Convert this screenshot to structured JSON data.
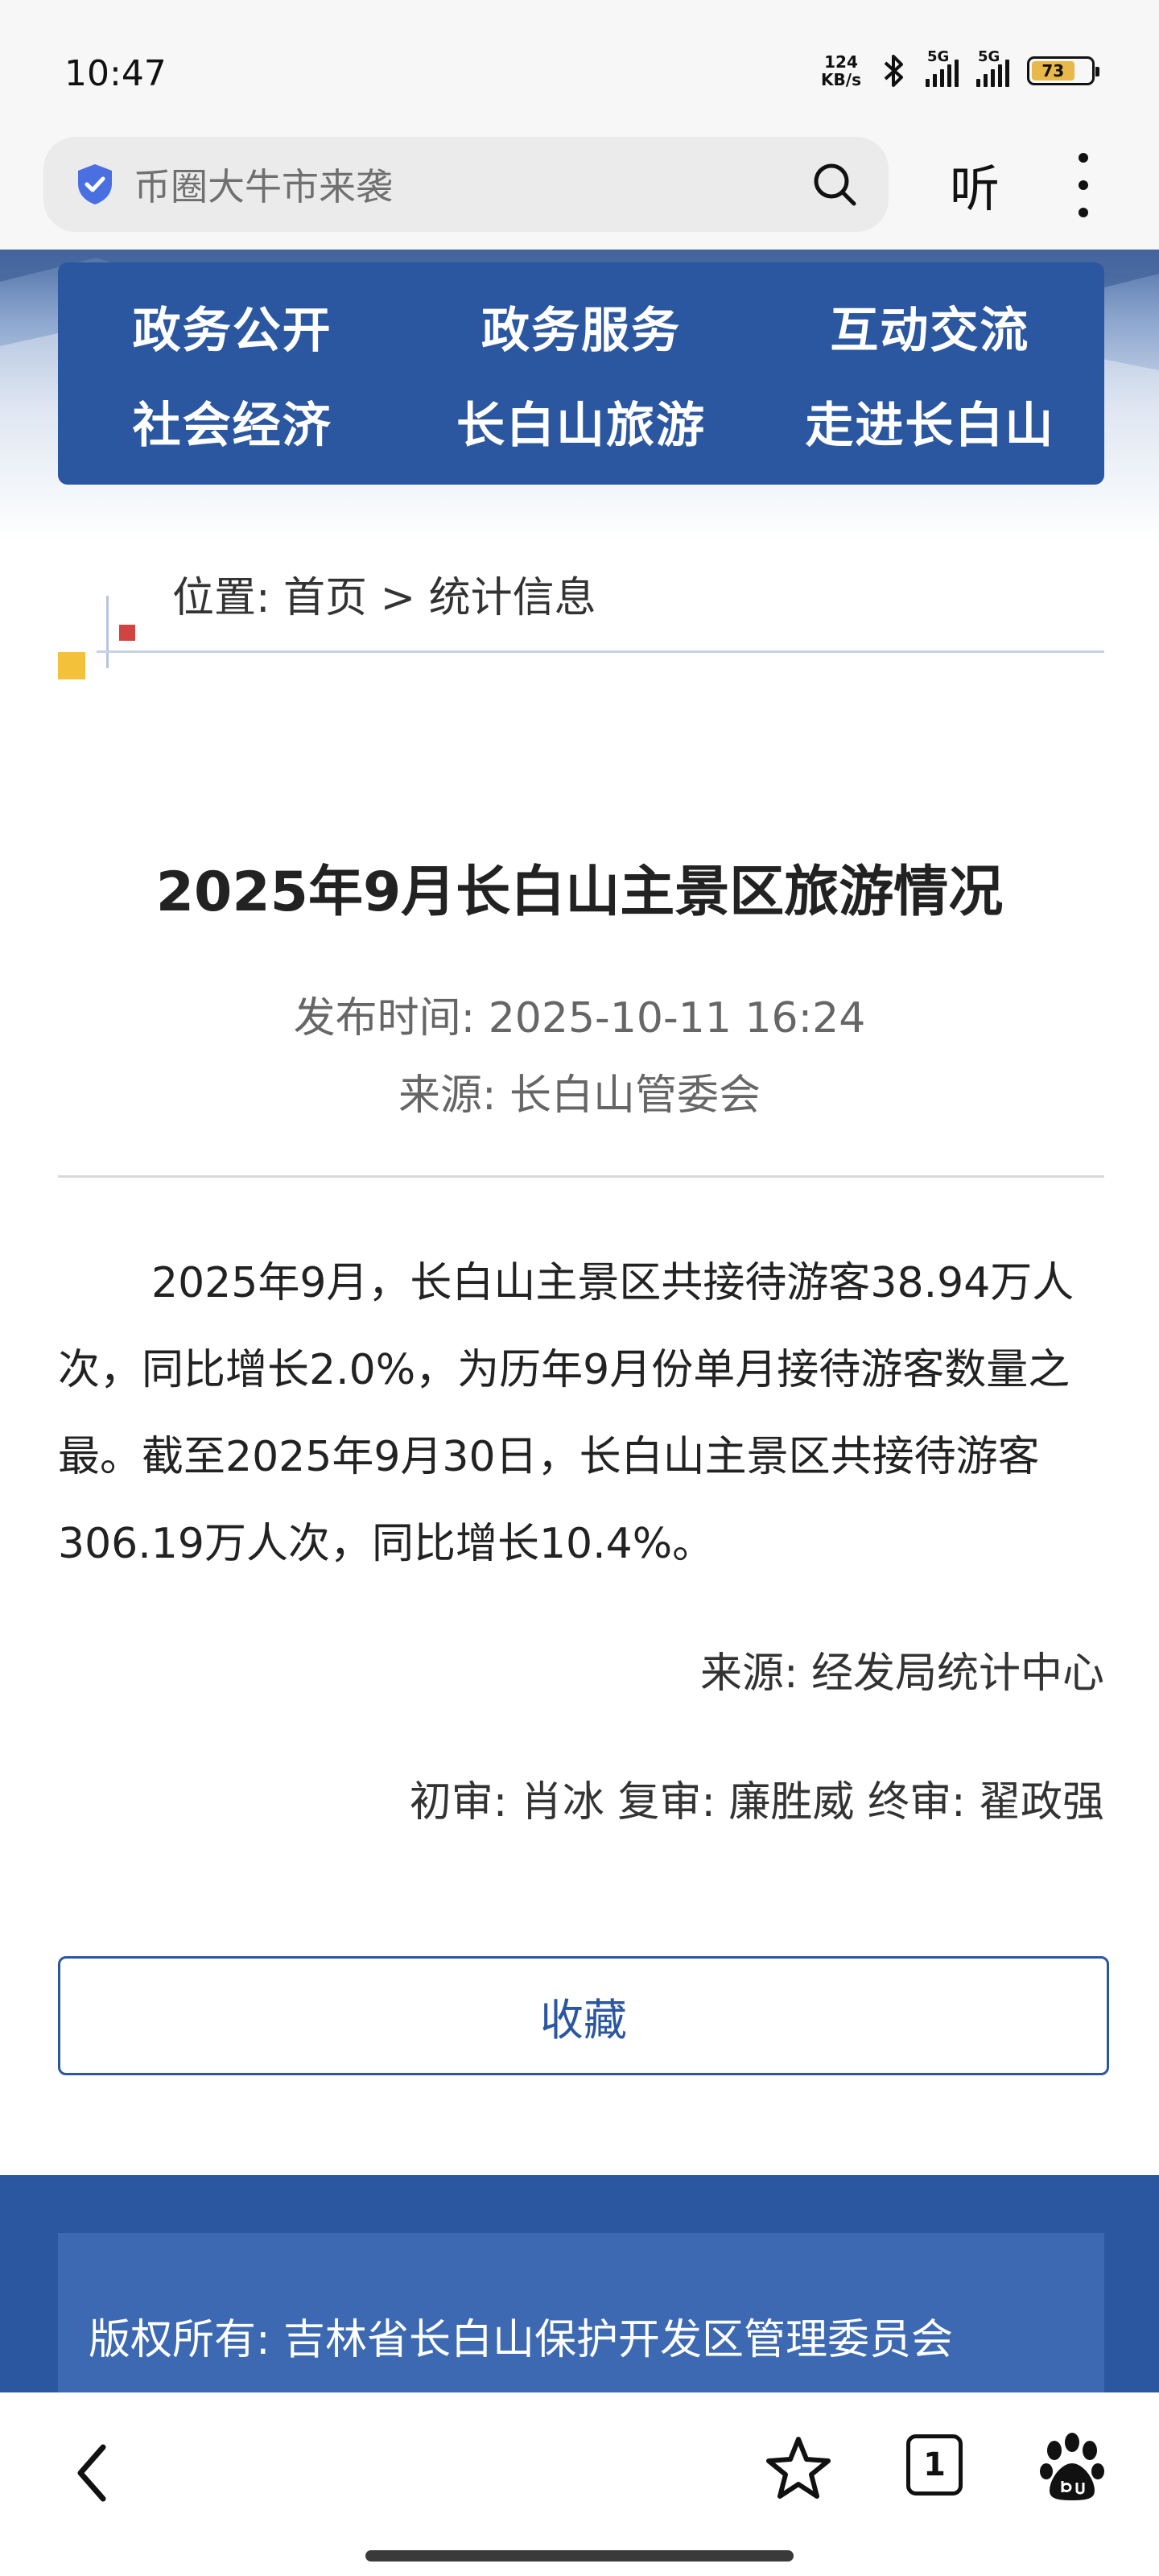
{
  "status_bar": {
    "time": "10:47",
    "net_speed_value": "124",
    "net_speed_unit": "KB/s",
    "signal1_label": "5G",
    "signal2_label": "5G",
    "battery_level": "73"
  },
  "browser": {
    "search_text": "币圈大牛市来袭",
    "listen_label": "听"
  },
  "nav": {
    "items": [
      {
        "label": "政务公开"
      },
      {
        "label": "政务服务"
      },
      {
        "label": "互动交流"
      },
      {
        "label": "社会经济"
      },
      {
        "label": "长白山旅游"
      },
      {
        "label": "走进长白山"
      }
    ]
  },
  "breadcrumb": {
    "text": "位置: 首页 > 统计信息"
  },
  "article": {
    "title": "2025年9月长白山主景区旅游情况",
    "publish_time": "发布时间: 2025-10-11 16:24",
    "source_header": "来源: 长白山管委会",
    "body": "2025年9月，长白山主景区共接待游客38.94万人次，同比增长2.0%，为历年9月份单月接待游客数量之最。截至2025年9月30日，长白山主景区共接待游客306.19万人次，同比增长10.4%。",
    "source_footer": "来源: 经发局统计中心",
    "review": "初审: 肖冰 复审: 廉胜威 终审: 翟政强",
    "favorite_label": "收藏"
  },
  "footer": {
    "copyright": "版权所有: 吉林省长白山保护开发区管理委员会"
  },
  "bottom_nav": {
    "tab_count": "1"
  },
  "colors": {
    "brand_blue": "#2b56a0",
    "accent_yellow": "#f3c13a",
    "accent_red": "#d04444"
  }
}
